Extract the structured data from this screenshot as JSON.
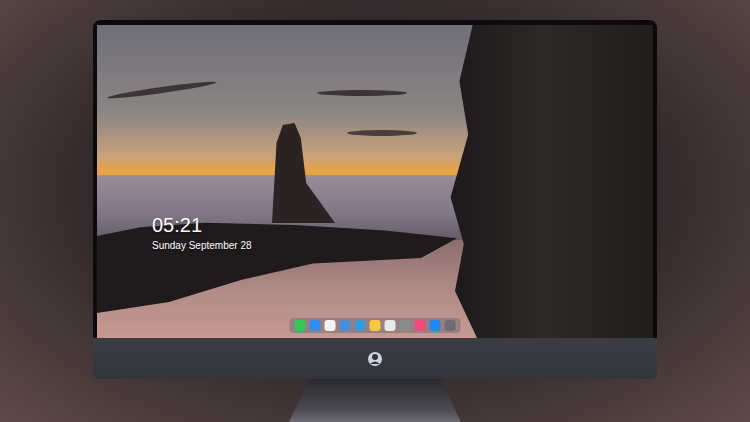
{
  "lock_screen": {
    "time": "05:21",
    "date": "Sunday September 28"
  },
  "dock": {
    "apps": [
      {
        "color": "#34c759"
      },
      {
        "color": "#2f8cf0"
      },
      {
        "color": "#f2f2f2"
      },
      {
        "color": "#4a8fd6"
      },
      {
        "color": "#3a9ad9"
      },
      {
        "color": "#f5c842"
      },
      {
        "color": "#e9e9e9"
      },
      {
        "color": "#8c8c8c"
      },
      {
        "color": "#f04a7a"
      },
      {
        "color": "#1e88f5"
      },
      {
        "color": "#6d6d72"
      }
    ]
  }
}
